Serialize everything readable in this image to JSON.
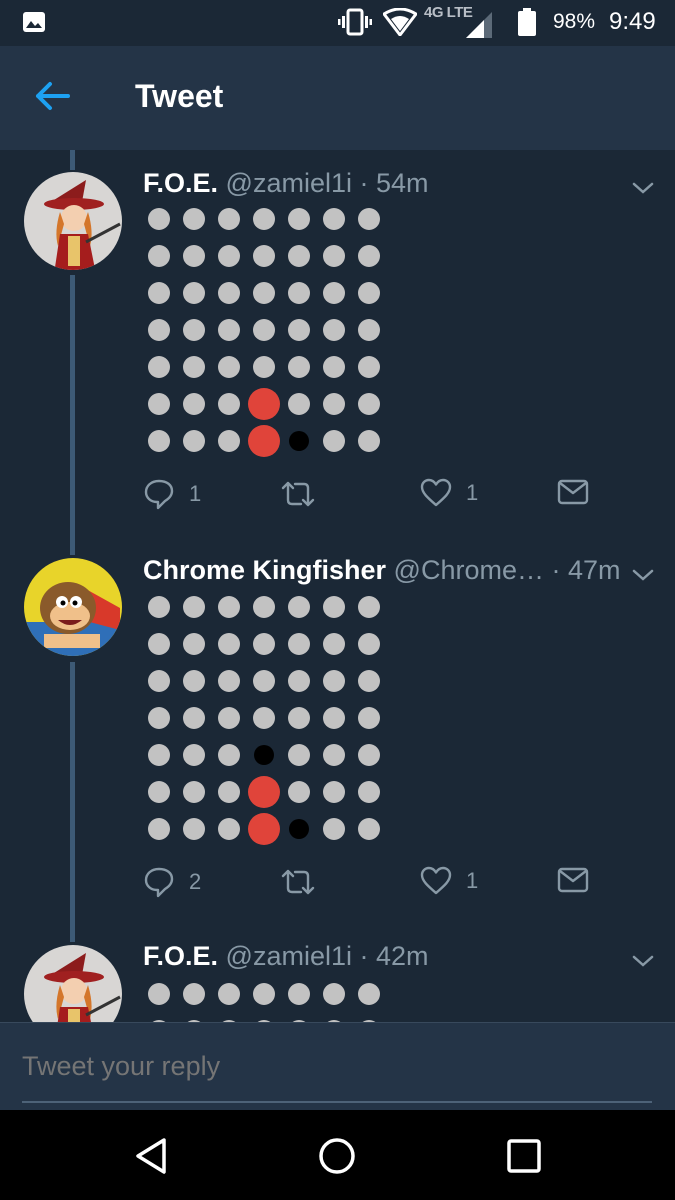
{
  "status_bar": {
    "icons": [
      "image-notification-icon",
      "vibrate-icon",
      "wifi-icon",
      "signal-icon",
      "battery-icon"
    ],
    "network": "4G LTE",
    "battery": "98%",
    "time": "9:49"
  },
  "header": {
    "back_icon": "back-arrow-icon",
    "title": "Tweet"
  },
  "colors": {
    "background": "#1b2836",
    "header": "#243447",
    "accent": "#1da1f2",
    "muted_text": "#8899a6",
    "dot_grey": "#c2c2c2",
    "dot_red": "#e0443a",
    "dot_black": "#000000"
  },
  "tweets": [
    {
      "name": "F.O.E.",
      "handle": "@zamiel1i",
      "time": "· 54m",
      "grid": [
        "ggggggg",
        "ggggggg",
        "ggggggg",
        "ggggggg",
        "ggggggg",
        "gggrggg",
        "gggrbgg"
      ],
      "replies": "1",
      "retweets": "",
      "likes": "1"
    },
    {
      "name": "Chrome Kingfisher",
      "handle": "@Chrome…",
      "time": "· 47m",
      "grid": [
        "ggggggg",
        "ggggggg",
        "ggggggg",
        "ggggggg",
        "gggbggg",
        "gggrggg",
        "gggrbgg"
      ],
      "replies": "2",
      "retweets": "",
      "likes": "1"
    },
    {
      "name": "F.O.E.",
      "handle": "@zamiel1i",
      "time": "· 42m",
      "grid": [
        "ggggggg",
        "ggggggg"
      ],
      "replies": "",
      "retweets": "",
      "likes": ""
    }
  ],
  "reply": {
    "placeholder": "Tweet your reply"
  },
  "nav": {
    "back": "nav-back-icon",
    "home": "nav-home-icon",
    "recents": "nav-recents-icon"
  }
}
